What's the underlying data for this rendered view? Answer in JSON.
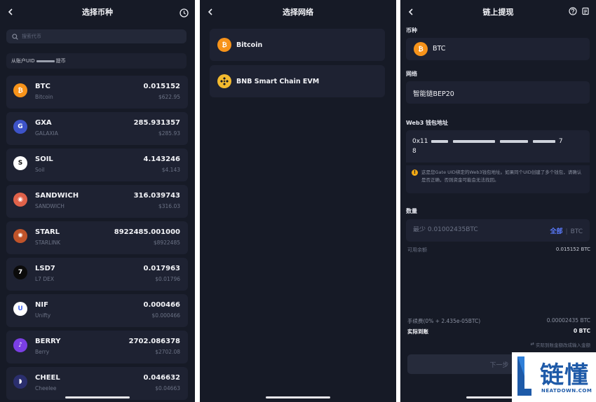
{
  "panel1": {
    "title": "选择币种",
    "search_placeholder": "搜索代币",
    "from_account_prefix": "从账户UID",
    "from_account_suffix": "提币",
    "coins": [
      {
        "symbol": "BTC",
        "name": "Bitcoin",
        "amount": "0.015152",
        "value": "$622.95",
        "icon": "bitcoin-icon",
        "color": "#f7931a"
      },
      {
        "symbol": "GXA",
        "name": "GALAXIA",
        "amount": "285.931357",
        "value": "$285.93",
        "icon": "galaxia-icon",
        "color": "#3d53c8"
      },
      {
        "symbol": "SOIL",
        "name": "Soil",
        "amount": "4.143246",
        "value": "$4.143",
        "icon": "soil-icon",
        "color": "#ffffff"
      },
      {
        "symbol": "SANDWICH",
        "name": "SANDWICH",
        "amount": "316.039743",
        "value": "$316.03",
        "icon": "sandwich-icon",
        "color": "#e0624a"
      },
      {
        "symbol": "STARL",
        "name": "STARLINK",
        "amount": "8922485.001000",
        "value": "$8922485",
        "icon": "starlink-icon",
        "color": "#c0542a"
      },
      {
        "symbol": "LSD7",
        "name": "L7 DEX",
        "amount": "0.017963",
        "value": "$0.01796",
        "icon": "l7-icon",
        "color": "#0b0b0b"
      },
      {
        "symbol": "NIF",
        "name": "Unifty",
        "amount": "0.000466",
        "value": "$0.000466",
        "icon": "unifty-icon",
        "color": "#ffffff"
      },
      {
        "symbol": "BERRY",
        "name": "Berry",
        "amount": "2702.086378",
        "value": "$2702.08",
        "icon": "berry-icon",
        "color": "#7b3fe4"
      },
      {
        "symbol": "CHEEL",
        "name": "Cheelee",
        "amount": "0.046632",
        "value": "$0.04663",
        "icon": "cheelee-icon",
        "color": "#2b2f6e"
      }
    ]
  },
  "panel2": {
    "title": "选择网络",
    "networks": [
      {
        "label": "Bitcoin",
        "icon": "bitcoin-icon",
        "color": "#f7931a"
      },
      {
        "label": "BNB Smart Chain EVM",
        "icon": "bnb-icon",
        "color": "#f3ba2f"
      }
    ]
  },
  "panel3": {
    "title": "链上提现",
    "coin_label": "币种",
    "coin_value": "BTC",
    "network_label": "网络",
    "network_value": "智能链BEP20",
    "address_label": "Web3 钱包地址",
    "address_start": "0x11",
    "address_end": "8",
    "address_tail": "7",
    "warning": "这是您Gate UID绑定的Web3钱包地址。如果同个UID创建了多个钱包，请确认是否正确，否则资金可能会无法找回。",
    "qty_label": "数量",
    "qty_placeholder": "最少 0.01002435BTC",
    "all_label": "全部",
    "unit": "BTC",
    "available_label": "可用余额",
    "available_value": "0.015152 BTC",
    "fee_label": "手续费(0% + 2.435e-05BTC)",
    "fee_value": "0.00002435 BTC",
    "receive_label": "实际到账",
    "receive_value": "0 BTC",
    "switch_note": "实际到账金额改成输入金额",
    "next_label": "下一步"
  },
  "watermark": {
    "cn": "链懂",
    "en": "NEATDOWN.COM"
  },
  "colors": {
    "background": "#161a26",
    "card": "#1e2232",
    "accent": "#5b7cff",
    "warning": "#f0a814"
  }
}
